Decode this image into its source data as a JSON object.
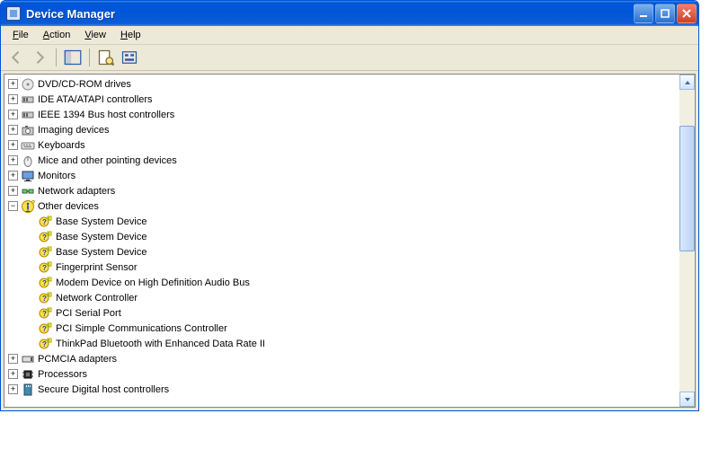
{
  "title": "Device Manager",
  "menus": {
    "file": "File",
    "action": "Action",
    "view": "View",
    "help": "Help"
  },
  "categories": [
    {
      "label": "DVD/CD-ROM drives",
      "icon": "disc"
    },
    {
      "label": "IDE ATA/ATAPI controllers",
      "icon": "controller"
    },
    {
      "label": "IEEE 1394 Bus host controllers",
      "icon": "controller"
    },
    {
      "label": "Imaging devices",
      "icon": "camera"
    },
    {
      "label": "Keyboards",
      "icon": "keyboard"
    },
    {
      "label": "Mice and other pointing devices",
      "icon": "mouse"
    },
    {
      "label": "Monitors",
      "icon": "monitor"
    },
    {
      "label": "Network adapters",
      "icon": "net"
    },
    {
      "label": "Other devices",
      "icon": "warn",
      "expanded": true,
      "children": [
        {
          "label": "Base System Device"
        },
        {
          "label": "Base System Device"
        },
        {
          "label": "Base System Device"
        },
        {
          "label": "Fingerprint Sensor"
        },
        {
          "label": "Modem Device on High Definition Audio Bus"
        },
        {
          "label": "Network Controller"
        },
        {
          "label": "PCI Serial Port"
        },
        {
          "label": "PCI Simple Communications Controller"
        },
        {
          "label": "ThinkPad Bluetooth with Enhanced Data Rate II"
        }
      ]
    },
    {
      "label": "PCMCIA adapters",
      "icon": "pcmcia"
    },
    {
      "label": "Processors",
      "icon": "cpu"
    },
    {
      "label": "Secure Digital host controllers",
      "icon": "sd"
    }
  ]
}
